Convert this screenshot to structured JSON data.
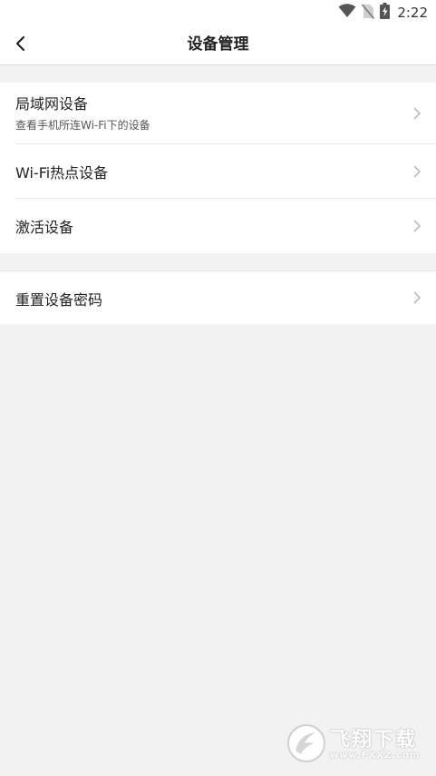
{
  "status_bar": {
    "time": "2:22",
    "icons": [
      "wifi-icon",
      "no-sim-icon",
      "battery-charging-icon"
    ]
  },
  "header": {
    "title": "设备管理",
    "back_icon": "chevron-left-icon"
  },
  "groups": [
    {
      "items": [
        {
          "label": "局域网设备",
          "subtitle": "查看手机所连Wi-Fi下的设备"
        },
        {
          "label": "Wi-Fi热点设备"
        },
        {
          "label": "激活设备"
        }
      ]
    },
    {
      "items": [
        {
          "label": "重置设备密码"
        }
      ]
    }
  ],
  "watermark": {
    "title": "飞翔下载",
    "url": "www.FXXZ.com"
  },
  "colors": {
    "background": "#f2f2f2",
    "surface": "#ffffff",
    "text": "#222222",
    "chevron": "#bbbbbb"
  }
}
